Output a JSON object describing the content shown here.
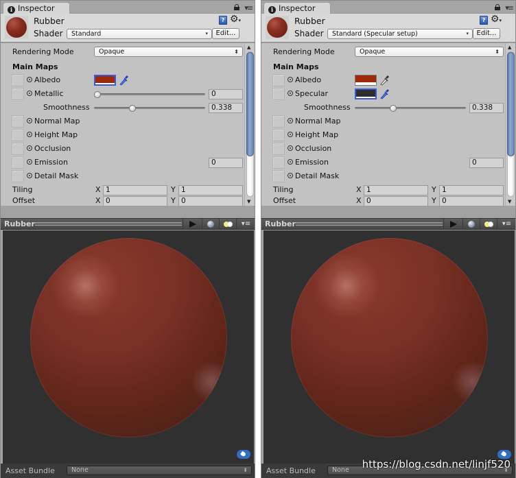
{
  "panels": [
    {
      "tab_label": "Inspector",
      "material_name": "Rubber",
      "shader_label": "Shader",
      "shader_value": "Standard",
      "edit_label": "Edit...",
      "rendering_mode_label": "Rendering Mode",
      "rendering_mode_value": "Opaque",
      "main_maps_label": "Main Maps",
      "albedo": {
        "label": "Albedo",
        "color": "#9c2a0a"
      },
      "second_map": {
        "label": "Metallic",
        "type": "slider",
        "value": "0",
        "slider_fraction": 0.0
      },
      "smoothness": {
        "label": "Smoothness",
        "value": "0.338",
        "slider_fraction": 0.338
      },
      "maps": [
        "Normal Map",
        "Height Map",
        "Occlusion",
        "Emission",
        "Detail Mask"
      ],
      "emission_value": "0",
      "tiling": {
        "label": "Tiling",
        "x_label": "X",
        "x": "1",
        "y_label": "Y",
        "y": "1"
      },
      "offset": {
        "label": "Offset",
        "x_label": "X",
        "x": "0",
        "y_label": "Y",
        "y": "0"
      },
      "preview_title": "Rubber",
      "asset_bundle_label": "Asset Bundle",
      "asset_bundle_value": "None"
    },
    {
      "tab_label": "Inspector",
      "material_name": "Rubber",
      "shader_label": "Shader",
      "shader_value": "Standard (Specular setup)",
      "edit_label": "Edit...",
      "rendering_mode_label": "Rendering Mode",
      "rendering_mode_value": "Opaque",
      "main_maps_label": "Main Maps",
      "albedo": {
        "label": "Albedo",
        "color": "#9c2a0a"
      },
      "second_map": {
        "label": "Specular",
        "type": "color",
        "color": "#2e2e2e"
      },
      "smoothness": {
        "label": "Smoothness",
        "value": "0.338",
        "slider_fraction": 0.338
      },
      "maps": [
        "Normal Map",
        "Height Map",
        "Occlusion",
        "Emission",
        "Detail Mask"
      ],
      "emission_value": "0",
      "tiling": {
        "label": "Tiling",
        "x_label": "X",
        "x": "1",
        "y_label": "Y",
        "y": "1"
      },
      "offset": {
        "label": "Offset",
        "x_label": "X",
        "x": "0",
        "y_label": "Y",
        "y": "0"
      },
      "preview_title": "Rubber",
      "asset_bundle_label": "Asset Bundle",
      "asset_bundle_value": "None"
    }
  ],
  "watermark": "https://blog.csdn.net/linjf520",
  "icons": {
    "info": "i",
    "help": "?",
    "gear": "⚙",
    "dropdown_arrow": "▾",
    "updown": "⇕",
    "menu": "▾≡",
    "scroll_up": "▲",
    "scroll_down": "▼"
  }
}
